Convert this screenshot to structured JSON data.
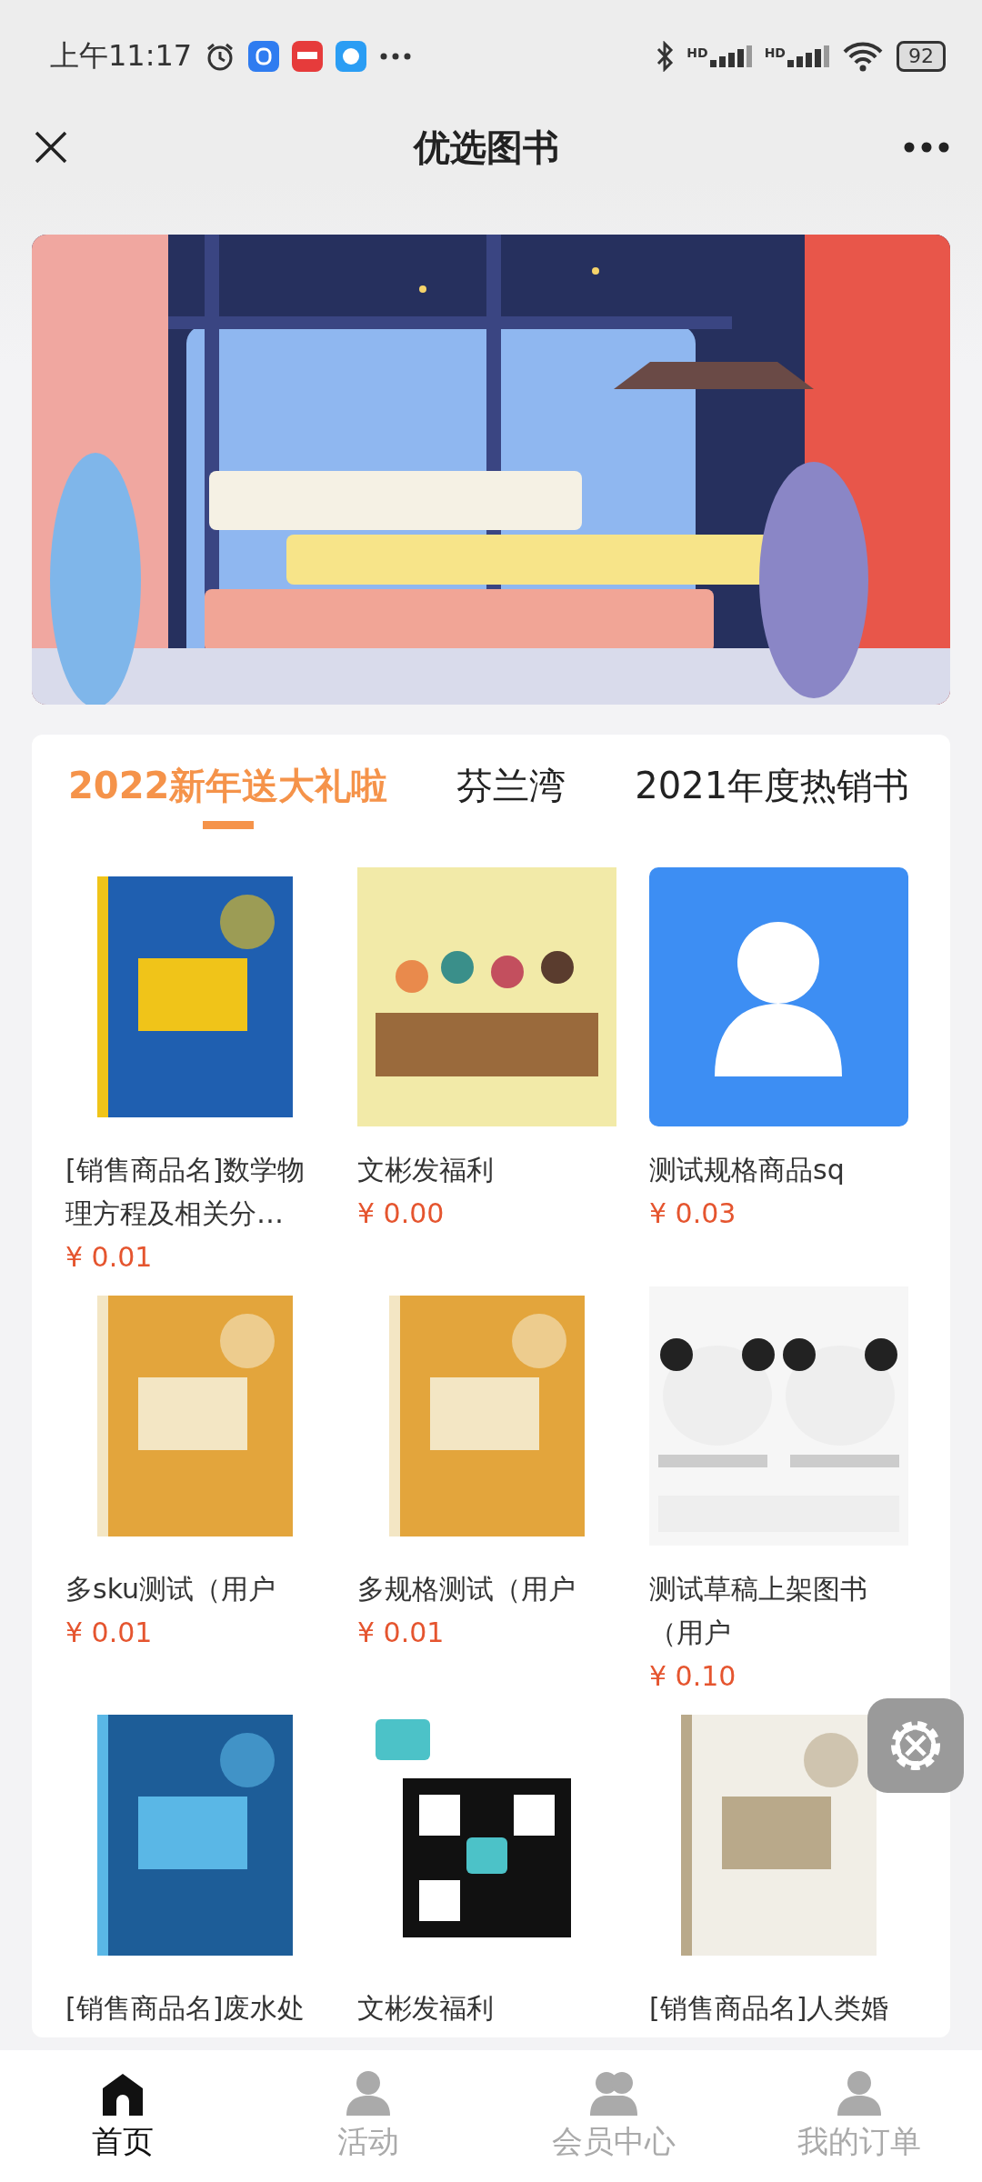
{
  "status_bar": {
    "time": "上午11:17",
    "networks": [
      {
        "label": "HD"
      },
      {
        "label": "HD"
      }
    ],
    "battery": "92"
  },
  "header": {
    "title": "优选图书"
  },
  "tabs": [
    {
      "label": "2022新年送大礼啦",
      "selected": true
    },
    {
      "label": "芬兰湾",
      "selected": false
    },
    {
      "label": "2021年度热销书",
      "selected": false
    }
  ],
  "products": [
    {
      "name": "[销售商品名]数学物理方程及相关分…",
      "price": "¥ 0.01",
      "kind": "picture"
    },
    {
      "name": "文彬发福利",
      "price": "¥ 0.00",
      "kind": "picture"
    },
    {
      "name": "测试规格商品sq",
      "price": "¥ 0.03",
      "kind": "placeholder"
    },
    {
      "name": "多sku测试（用户",
      "price": "¥ 0.01",
      "kind": "picture"
    },
    {
      "name": "多规格测试（用户",
      "price": "¥ 0.01",
      "kind": "picture"
    },
    {
      "name": "测试草稿上架图书（用户",
      "price": "¥ 0.10",
      "kind": "picture"
    },
    {
      "name": "[销售商品名]废水处",
      "kind": "picture"
    },
    {
      "name": "文彬发福利",
      "kind": "picture"
    },
    {
      "name": "[销售商品名]人类婚",
      "kind": "picture"
    }
  ],
  "bottom_nav": [
    {
      "label": "首页",
      "kind": "home",
      "selected": true
    },
    {
      "label": "活动",
      "kind": "person",
      "selected": false
    },
    {
      "label": "会员中心",
      "kind": "people",
      "selected": false
    },
    {
      "label": "我的订单",
      "kind": "person",
      "selected": false
    }
  ]
}
